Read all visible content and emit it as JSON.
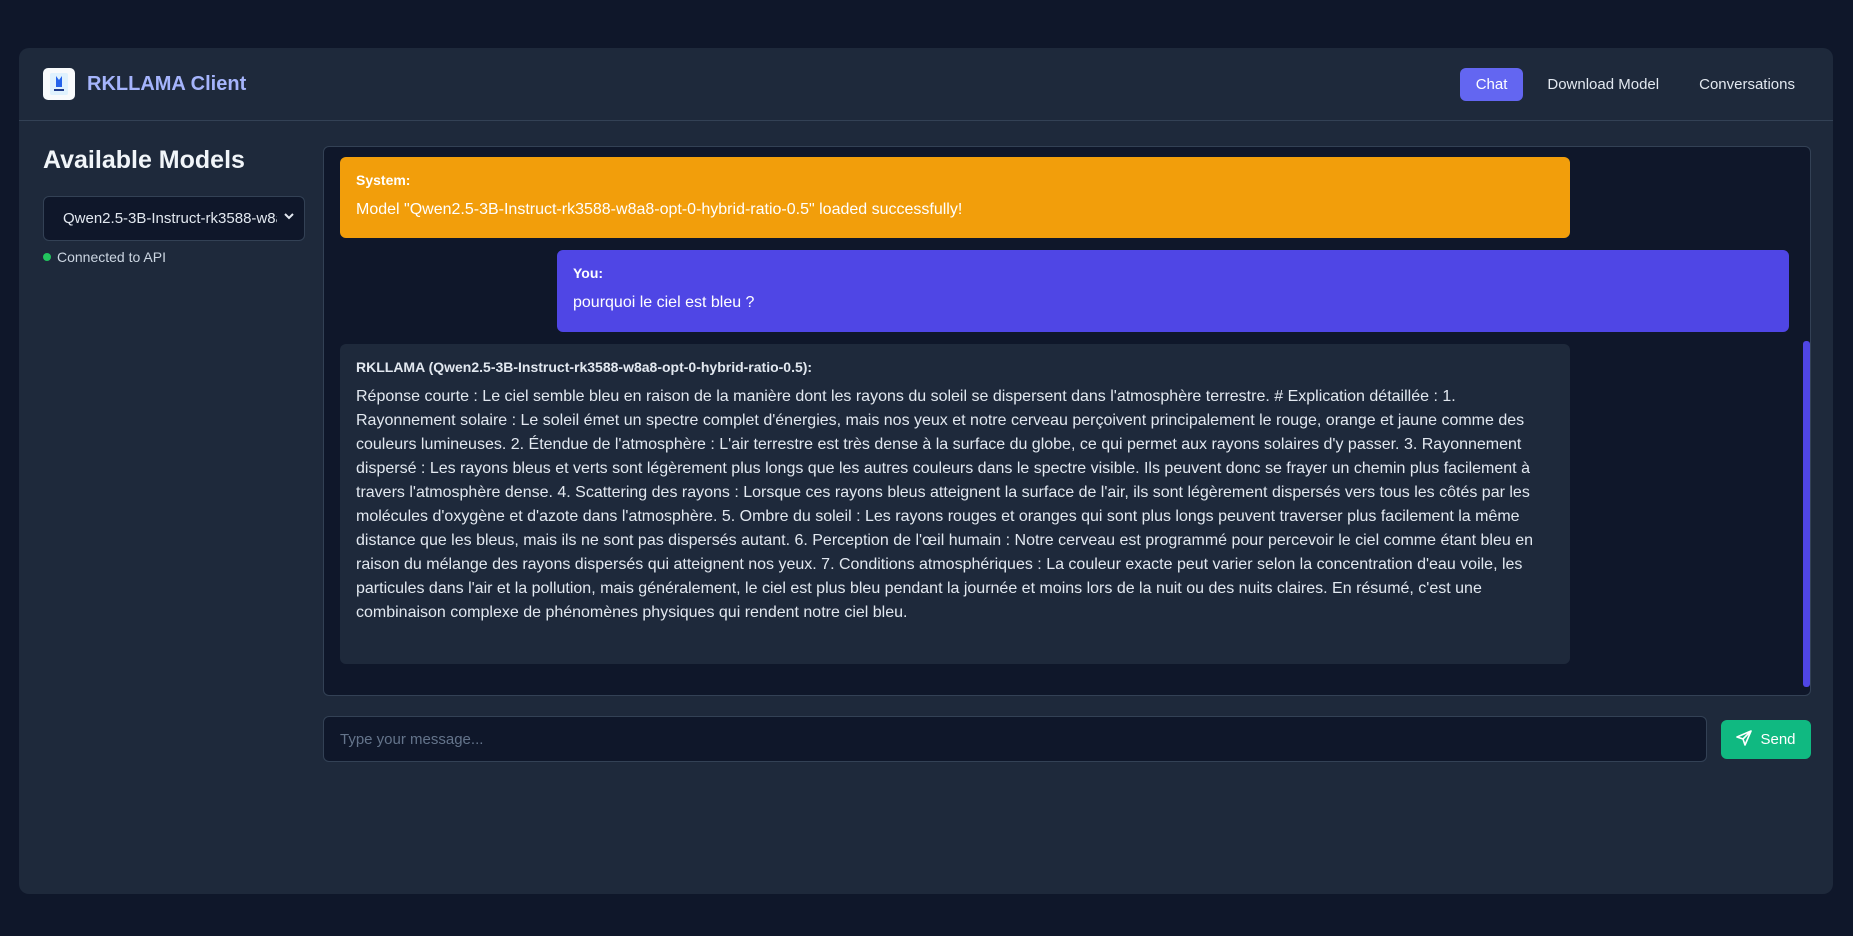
{
  "app": {
    "title": "RKLLAMA Client",
    "logo_icon": "rkllama-logo-icon"
  },
  "nav": {
    "items": [
      {
        "label": "Chat",
        "active": true
      },
      {
        "label": "Download Model",
        "active": false
      },
      {
        "label": "Conversations",
        "active": false
      }
    ]
  },
  "sidebar": {
    "heading": "Available Models",
    "selected_model": "Qwen2.5-3B-Instruct-rk3588-w8a8-opt-0-hybrid-ratio-0.5",
    "status_text": "Connected to API",
    "status_color": "#22c55e"
  },
  "chat": {
    "messages": [
      {
        "role": "system",
        "sender": "System:",
        "text": "Model \"Qwen2.5-3B-Instruct-rk3588-w8a8-opt-0-hybrid-ratio-0.5\" loaded successfully!"
      },
      {
        "role": "user",
        "sender": "You:",
        "text": "pourquoi le ciel est bleu ?"
      },
      {
        "role": "assistant",
        "sender": "RKLLAMA (Qwen2.5-3B-Instruct-rk3588-w8a8-opt-0-hybrid-ratio-0.5):",
        "text": "Réponse courte : Le ciel semble bleu en raison de la manière dont les rayons du soleil se dispersent dans l'atmosphère terrestre. # Explication détaillée : 1. Rayonnement solaire : Le soleil émet un spectre complet d'énergies, mais nos yeux et notre cerveau perçoivent principalement le rouge, orange et jaune comme des couleurs lumineuses. 2. Étendue de l'atmosphère : L'air terrestre est très dense à la surface du globe, ce qui permet aux rayons solaires d'y passer. 3. Rayonnement dispersé : Les rayons bleus et verts sont légèrement plus longs que les autres couleurs dans le spectre visible. Ils peuvent donc se frayer un chemin plus facilement à travers l'atmosphère dense. 4. Scattering des rayons : Lorsque ces rayons bleus atteignent la surface de l'air, ils sont légèrement dispersés vers tous les côtés par les molécules d'oxygène et d'azote dans l'atmosphère. 5. Ombre du soleil : Les rayons rouges et oranges qui sont plus longs peuvent traverser plus facilement la même distance que les bleus, mais ils ne sont pas dispersés autant. 6. Perception de l'œil humain : Notre cerveau est programmé pour percevoir le ciel comme étant bleu en raison du mélange des rayons dispersés qui atteignent nos yeux. 7. Conditions atmosphériques : La couleur exacte peut varier selon la concentration d'eau voile, les particules dans l'air et la pollution, mais généralement, le ciel est plus bleu pendant la journée et moins lors de la nuit ou des nuits claires. En résumé, c'est une combinaison complexe de phénomènes physiques qui rendent notre ciel bleu."
      }
    ]
  },
  "composer": {
    "placeholder": "Type your message...",
    "value": "",
    "send_label": "Send",
    "send_icon": "paper-plane-icon"
  },
  "colors": {
    "accent": "#6366f1",
    "system_bubble": "#f29e0b",
    "user_bubble": "#4f46e5",
    "send_button": "#10b981"
  }
}
